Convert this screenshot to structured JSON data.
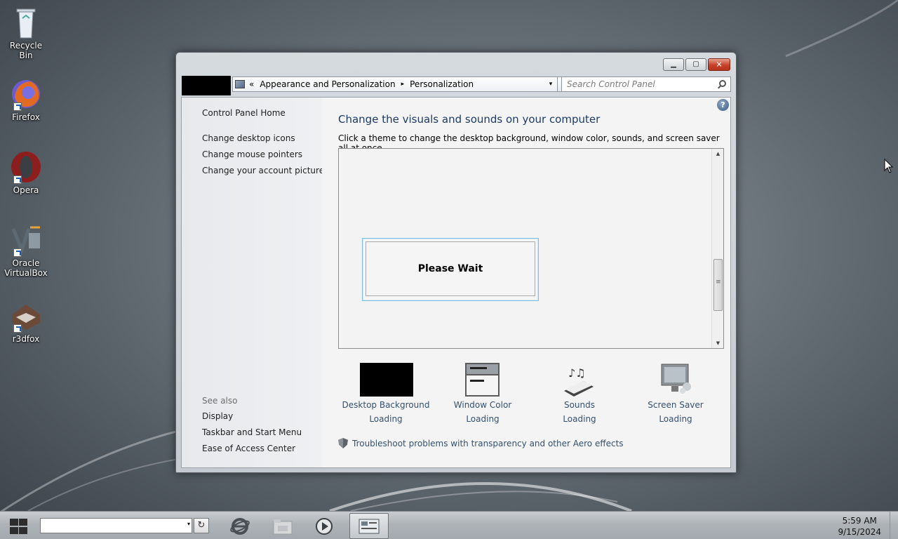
{
  "desktop": {
    "icons": [
      {
        "label": "Recycle Bin",
        "icon": "recycle-bin-icon"
      },
      {
        "label": "Firefox",
        "icon": "firefox-icon"
      },
      {
        "label": "Opera",
        "icon": "opera-icon"
      },
      {
        "label": "Oracle VirtualBox",
        "icon": "virtualbox-icon"
      },
      {
        "label": "r3dfox",
        "icon": "r3dfox-icon"
      }
    ]
  },
  "window": {
    "caption_buttons": {
      "minimize": "minimize",
      "maximize": "maximize",
      "close": "close"
    },
    "address": {
      "chevron": "«",
      "crumb1": "Appearance and Personalization",
      "arrow": "▸",
      "crumb2": "Personalization",
      "dropdown": "▾",
      "refresh": "↻"
    },
    "search": {
      "placeholder": "Search Control Panel"
    },
    "sidebar": {
      "home": "Control Panel Home",
      "links": [
        "Change desktop icons",
        "Change mouse pointers",
        "Change your account picture"
      ],
      "see_also_heading": "See also",
      "see_also": [
        "Display",
        "Taskbar and Start Menu",
        "Ease of Access Center"
      ]
    },
    "main": {
      "help": "?",
      "title": "Change the visuals and sounds on your computer",
      "description": "Click a theme to change the desktop background, window color, sounds, and screen saver all at once.",
      "please_wait": "Please Wait",
      "options": [
        {
          "label": "Desktop Background",
          "status": "Loading",
          "icon": "desktop-background-icon"
        },
        {
          "label": "Window Color",
          "status": "Loading",
          "icon": "window-color-icon"
        },
        {
          "label": "Sounds",
          "status": "Loading",
          "icon": "sounds-icon"
        },
        {
          "label": "Screen Saver",
          "status": "Loading",
          "icon": "screen-saver-icon"
        }
      ],
      "troubleshoot": "Troubleshoot problems with transparency and other Aero effects"
    }
  },
  "taskbar": {
    "address_value": "",
    "dropdown": "▾",
    "refresh": "↻",
    "time": "5:59 AM",
    "date": "9/15/2024"
  },
  "colors": {
    "accent": "#1e3a62",
    "link": "#34506f"
  }
}
